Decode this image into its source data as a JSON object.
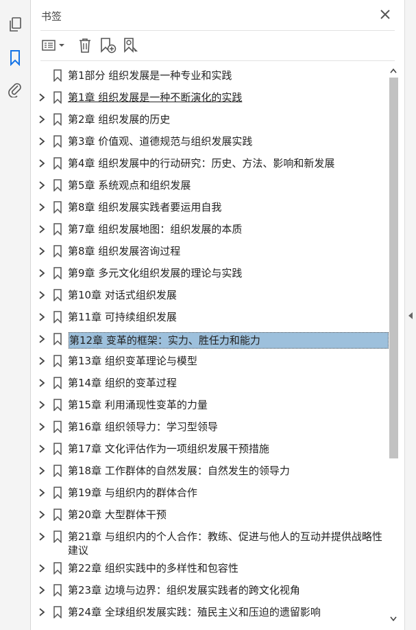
{
  "panel": {
    "title": "书签"
  },
  "colors": {
    "selection": "#9dc0dc",
    "icon": "#555555",
    "accent": "#1473e6"
  },
  "rail_icons": [
    "pages-icon",
    "bookmark-icon",
    "attachment-icon"
  ],
  "bookmarks": [
    {
      "label": "第1部分  组织发展是一种专业和实践",
      "expandable": false
    },
    {
      "label": "第1章  组织发展是一种不断演化的实践",
      "expandable": true,
      "underline": true
    },
    {
      "label": "第2章  组织发展的历史",
      "expandable": true
    },
    {
      "label": "第3章  价值观、道德规范与组织发展实践",
      "expandable": true
    },
    {
      "label": "第4章  组织发展中的行动研究：历史、方法、影响和新发展",
      "expandable": true
    },
    {
      "label": "第5章  系统观点和组织发展",
      "expandable": true
    },
    {
      "label": "第8章  组织发展实践者要运用自我",
      "expandable": true
    },
    {
      "label": "第7章  组织发展地图：组织发展的本质",
      "expandable": true
    },
    {
      "label": "第8章  组织发展咨询过程",
      "expandable": true
    },
    {
      "label": "第9章  多元文化组织发展的理论与实践",
      "expandable": true
    },
    {
      "label": "第10章  对话式组织发展",
      "expandable": true
    },
    {
      "label": "第11章  可持续组织发展",
      "expandable": true
    },
    {
      "label": "第12章  变革的框架：实力、胜任力和能力",
      "expandable": true,
      "selected": true
    },
    {
      "label": "第13章  组织变革理论与模型",
      "expandable": true
    },
    {
      "label": "第14章  组织的变革过程",
      "expandable": true
    },
    {
      "label": "第15章  利用涌现性变革的力量",
      "expandable": true
    },
    {
      "label": "第16章  组织领导力：学习型领导",
      "expandable": true
    },
    {
      "label": "第17章  文化评估作为一项组织发展干预措施",
      "expandable": true
    },
    {
      "label": "第18章  工作群体的自然发展：自然发生的领导力",
      "expandable": true
    },
    {
      "label": "第19章  与组织内的群体合作",
      "expandable": true
    },
    {
      "label": "第20章  大型群体干预",
      "expandable": true
    },
    {
      "label": "第21章  与组织内的个人合作：教练、促进与他人的互动并提供战略性建议",
      "expandable": true
    },
    {
      "label": "第22章  组织实践中的多样性和包容性",
      "expandable": true
    },
    {
      "label": "第23章  边境与边界：组织发展实践者的跨文化视角",
      "expandable": true
    },
    {
      "label": "第24章  全球组织发展实践：殖民主义和压迫的遗留影响",
      "expandable": true
    }
  ]
}
